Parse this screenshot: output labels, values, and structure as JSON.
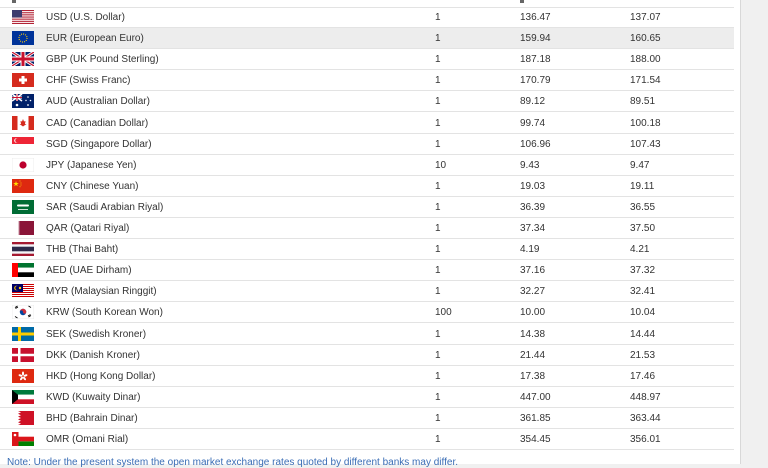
{
  "rates": [
    {
      "flag": "us-flag-icon",
      "currency": "USD (U.S. Dollar)",
      "unit": "1",
      "buy": "136.47",
      "sell": "137.07"
    },
    {
      "flag": "eu-flag-icon",
      "currency": "EUR (European Euro)",
      "unit": "1",
      "buy": "159.94",
      "sell": "160.65"
    },
    {
      "flag": "uk-flag-icon",
      "currency": "GBP (UK Pound Sterling)",
      "unit": "1",
      "buy": "187.18",
      "sell": "188.00"
    },
    {
      "flag": "ch-flag-icon",
      "currency": "CHF (Swiss Franc)",
      "unit": "1",
      "buy": "170.79",
      "sell": "171.54"
    },
    {
      "flag": "au-flag-icon",
      "currency": "AUD (Australian Dollar)",
      "unit": "1",
      "buy": "89.12",
      "sell": "89.51"
    },
    {
      "flag": "ca-flag-icon",
      "currency": "CAD (Canadian Dollar)",
      "unit": "1",
      "buy": "99.74",
      "sell": "100.18"
    },
    {
      "flag": "sg-flag-icon",
      "currency": "SGD (Singapore Dollar)",
      "unit": "1",
      "buy": "106.96",
      "sell": "107.43"
    },
    {
      "flag": "jp-flag-icon",
      "currency": "JPY (Japanese Yen)",
      "unit": "10",
      "buy": "9.43",
      "sell": "9.47"
    },
    {
      "flag": "cn-flag-icon",
      "currency": "CNY (Chinese Yuan)",
      "unit": "1",
      "buy": "19.03",
      "sell": "19.11"
    },
    {
      "flag": "sa-flag-icon",
      "currency": "SAR (Saudi Arabian Riyal)",
      "unit": "1",
      "buy": "36.39",
      "sell": "36.55"
    },
    {
      "flag": "qa-flag-icon",
      "currency": "QAR (Qatari Riyal)",
      "unit": "1",
      "buy": "37.34",
      "sell": "37.50"
    },
    {
      "flag": "th-flag-icon",
      "currency": "THB (Thai Baht)",
      "unit": "1",
      "buy": "4.19",
      "sell": "4.21"
    },
    {
      "flag": "ae-flag-icon",
      "currency": "AED (UAE Dirham)",
      "unit": "1",
      "buy": "37.16",
      "sell": "37.32"
    },
    {
      "flag": "my-flag-icon",
      "currency": "MYR (Malaysian Ringgit)",
      "unit": "1",
      "buy": "32.27",
      "sell": "32.41"
    },
    {
      "flag": "kr-flag-icon",
      "currency": "KRW (South Korean Won)",
      "unit": "100",
      "buy": "10.00",
      "sell": "10.04"
    },
    {
      "flag": "se-flag-icon",
      "currency": "SEK (Swedish Kroner)",
      "unit": "1",
      "buy": "14.38",
      "sell": "14.44"
    },
    {
      "flag": "dk-flag-icon",
      "currency": "DKK (Danish Kroner)",
      "unit": "1",
      "buy": "21.44",
      "sell": "21.53"
    },
    {
      "flag": "hk-flag-icon",
      "currency": "HKD (Hong Kong Dollar)",
      "unit": "1",
      "buy": "17.38",
      "sell": "17.46"
    },
    {
      "flag": "kw-flag-icon",
      "currency": "KWD (Kuwaity Dinar)",
      "unit": "1",
      "buy": "447.00",
      "sell": "448.97"
    },
    {
      "flag": "bh-flag-icon",
      "currency": "BHD (Bahrain Dinar)",
      "unit": "1",
      "buy": "361.85",
      "sell": "363.44"
    },
    {
      "flag": "om-flag-icon",
      "currency": "OMR (Omani Rial)",
      "unit": "1",
      "buy": "354.45",
      "sell": "356.01"
    }
  ],
  "highlighted_row": 1,
  "note": "Note: Under the present system the open market exchange rates quoted by different banks may differ."
}
